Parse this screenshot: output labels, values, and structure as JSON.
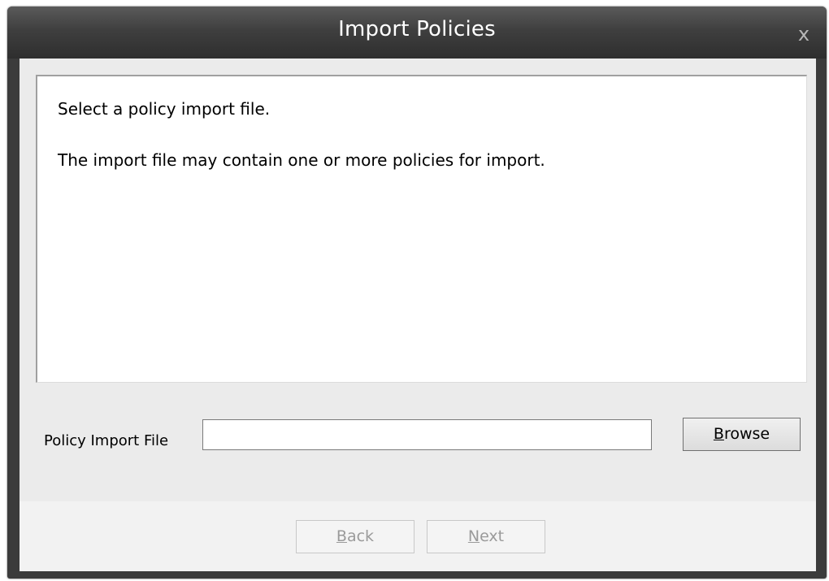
{
  "window": {
    "title": "Import Policies",
    "close_glyph": "x"
  },
  "description": {
    "line1": "Select a policy import file.",
    "line2": "The import file may contain one or more policies for import."
  },
  "file": {
    "label": "Policy Import File",
    "value": "",
    "browse_mnemonic": "B",
    "browse_rest": "rowse"
  },
  "footer": {
    "back_mnemonic": "B",
    "back_rest": "ack",
    "back_enabled": false,
    "next_mnemonic": "N",
    "next_rest": "ext",
    "next_enabled": false
  },
  "colors": {
    "titlebar": "#3b3b3b",
    "client_bg": "#ebebeb",
    "disabled_text": "#9a9a9a"
  },
  "icons": {
    "close": "close-icon"
  }
}
